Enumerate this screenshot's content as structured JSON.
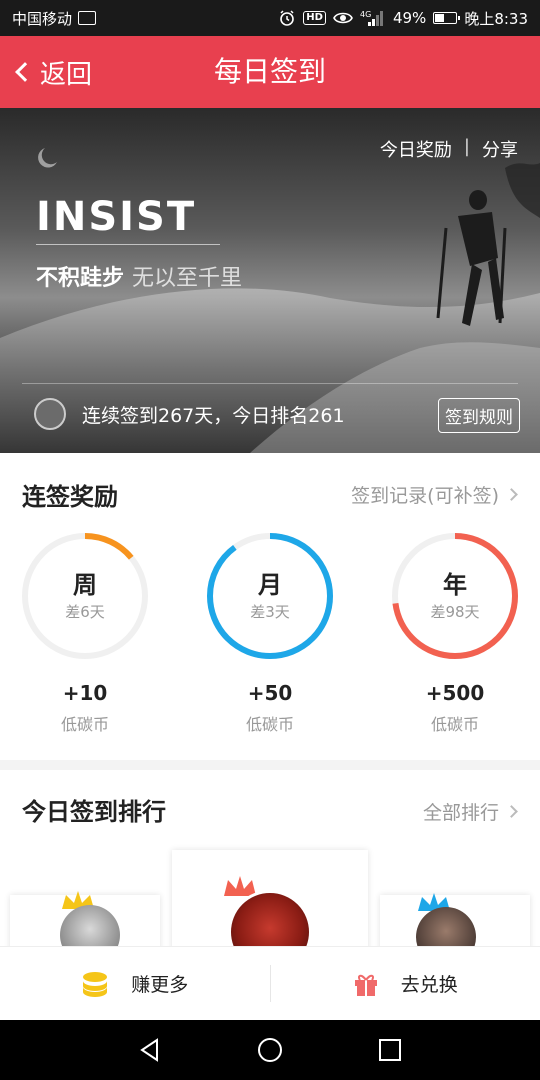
{
  "status_bar": {
    "carrier": "中国移动",
    "battery": "49%",
    "time": "晚上8:33",
    "network": "4G"
  },
  "nav": {
    "back_label": "返回",
    "title": "每日签到"
  },
  "banner": {
    "today_reward": "今日奖励",
    "separator": "|",
    "share": "分享",
    "headline": "INSIST",
    "slogan_main": "不积跬步",
    "slogan_sub": "无以至千里",
    "streak_text": "连续签到267天，今日排名261",
    "rules_button": "签到规则"
  },
  "rewards": {
    "title": "连签奖励",
    "records_link": "签到记录(可补签)",
    "items": [
      {
        "label": "周",
        "remaining": "差6天",
        "points": "+10",
        "unit": "低碳币",
        "progress": 0.14,
        "color": "#f7931e"
      },
      {
        "label": "月",
        "remaining": "差3天",
        "points": "+50",
        "unit": "低碳币",
        "progress": 0.9,
        "color": "#1ea7e8"
      },
      {
        "label": "年",
        "remaining": "差98天",
        "points": "+500",
        "unit": "低碳币",
        "progress": 0.73,
        "color": "#f26150"
      }
    ]
  },
  "ranking": {
    "title": "今日签到排行",
    "all_link": "全部排行"
  },
  "actions": {
    "earn": "赚更多",
    "redeem": "去兑换"
  },
  "colors": {
    "brand": "#e8404f",
    "coin": "#f5c518",
    "gift": "#f06a6a"
  }
}
